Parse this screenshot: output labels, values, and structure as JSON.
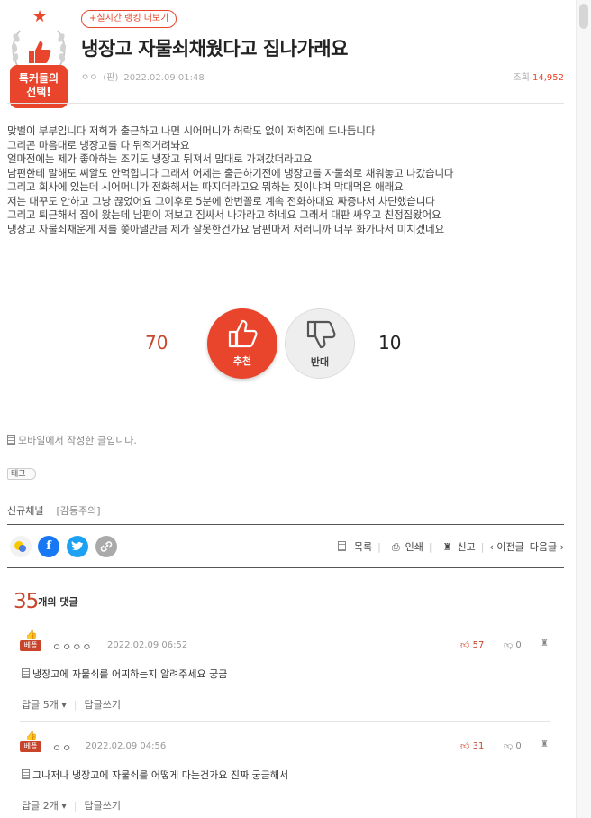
{
  "badge": {
    "line1": "톡커들의",
    "line2": "선택!"
  },
  "header": {
    "ranking_button": "+실시간 랭킹 더보기",
    "title": "냉장고 자물쇠채웠다고 집나가래요",
    "author": "ㅇㅇ",
    "author_tag": "(판)",
    "datetime": "2022.02.09 01:48",
    "views_label": "조회",
    "views_value": "14,952"
  },
  "post": {
    "lines": [
      "맞벌이 부부입니다 저희가 출근하고 나면 시어머니가 허락도 없이 저희집에 드나듭니다",
      "그리곤 마음대로 냉장고를 다 뒤적거려놔요",
      "얼마전에는 제가 좋아하는 조기도 냉장고 뒤져서 맘대로 가져갔더라고요",
      "남편한테 말해도 씨알도 안먹힙니다 그래서 어제는 출근하기전에 냉장고를 자물쇠로 채워놓고 나갔습니다",
      "그리고 회사에 있는데 시어머니가 전화해서는 따지더라고요 뭐하는 짓이냐며 막대먹은 애래요",
      "저는 대꾸도 안하고 그냥 끊었어요 그이후로 5분에 한번꼴로 계속 전화하대요 짜증나서 차단했습니다",
      "그리고 퇴근해서 집에 왔는데 남편이 저보고 짐싸서 나가라고 하네요 그래서 대판 싸우고 친정집왔어요",
      "냉장고 자물쇠채운게 저를 쫒아낼만큼 제가 잘못한건가요 남편마저 저러니까 너무 화가나서 미치겠네요"
    ],
    "recommend_count": "70",
    "recommend_label": "추천",
    "oppose_count": "10",
    "oppose_label": "반대",
    "mobile_note": "모바일에서 작성한 글입니다.",
    "tag_label": "태그",
    "channel": "신규채널",
    "category": "[감동주의]"
  },
  "actions": {
    "list": "목록",
    "print": "인쇄",
    "report": "신고",
    "prev": "‹ 이전글",
    "next": "다음글 ›"
  },
  "comments_header": {
    "count": "35",
    "label": "개의 댓글"
  },
  "comments": [
    {
      "best_label": "베플",
      "author": "ㅇㅇㅇㅇ",
      "datetime": "2022.02.09 06:52",
      "up": "57",
      "down": "0",
      "text": "냉장고에 자물쇠를 어찌하는지 알려주세요 궁금",
      "replies": "답글 5개",
      "write_reply": "답글쓰기"
    },
    {
      "best_label": "베플",
      "author": "ㅇㅇ",
      "datetime": "2022.02.09 04:56",
      "up": "31",
      "down": "0",
      "text": "그나저나 냉장고에 자물쇠를 어떻게 다는건가요 진짜 궁금해서",
      "replies": "답글 2개",
      "write_reply": "답글쓰기"
    }
  ],
  "colors": {
    "accent": "#e8452c",
    "best": "#c8452c",
    "facebook": "#1877f2",
    "twitter": "#1da1f2"
  }
}
